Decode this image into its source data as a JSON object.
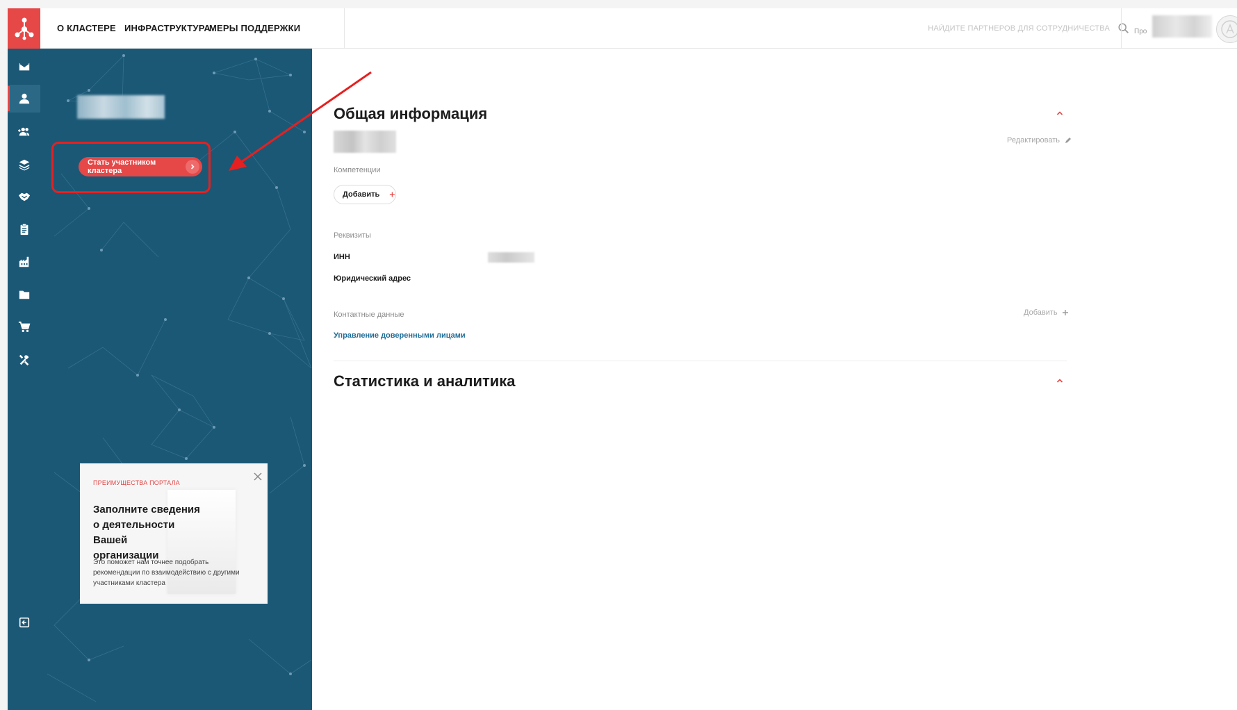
{
  "colors": {
    "brand_red": "#e64747",
    "panel_blue": "#1b5876",
    "link_blue": "#1f6c95",
    "annotation_red": "#e62020"
  },
  "header": {
    "logo_icon": "cluster-network-icon",
    "nav": [
      {
        "label": "О КЛАСТЕРЕ"
      },
      {
        "label": "ИНФРАСТРУКТУРА"
      },
      {
        "label": "МЕРЫ ПОДДЕРЖКИ"
      }
    ],
    "search": {
      "placeholder": "НАЙДИТЕ ПАРТНЕРОВ ДЛЯ СОТРУДНИЧЕСТВА",
      "icon": "search-icon"
    },
    "profile": {
      "label": "Про",
      "avatar_icon": "user-avatar-icon"
    }
  },
  "rail": {
    "icons": [
      "mail-icon",
      "user-icon",
      "users-add-icon",
      "layers-icon",
      "handshake-icon",
      "clipboard-icon",
      "factory-icon",
      "folder-icon",
      "cart-icon",
      "tools-icon",
      "logout-icon"
    ],
    "active_index": 1
  },
  "panel": {
    "join_button": "Стать участником кластера",
    "promo": {
      "tag": "ПРЕИМУЩЕСТВА ПОРТАЛА",
      "title_lines": [
        "Заполните сведения",
        "о деятельности Вашей",
        "организации"
      ],
      "text_lines": [
        "Это поможет нам точнее подобрать",
        "рекомендации по взаимодействию с другими",
        "участниками кластера"
      ]
    }
  },
  "main": {
    "general": {
      "title": "Общая информация",
      "edit": "Редактировать",
      "competencies_label": "Компетенции",
      "add_button": "Добавить",
      "requisites_label": "Реквизиты",
      "inn_label": "ИНН",
      "address_label": "Юридический адрес",
      "contacts_label": "Контактные данные",
      "contacts_add": "Добавить",
      "proxy_link": "Управление доверенными лицами"
    },
    "stats": {
      "title": "Статистика и аналитика"
    }
  }
}
